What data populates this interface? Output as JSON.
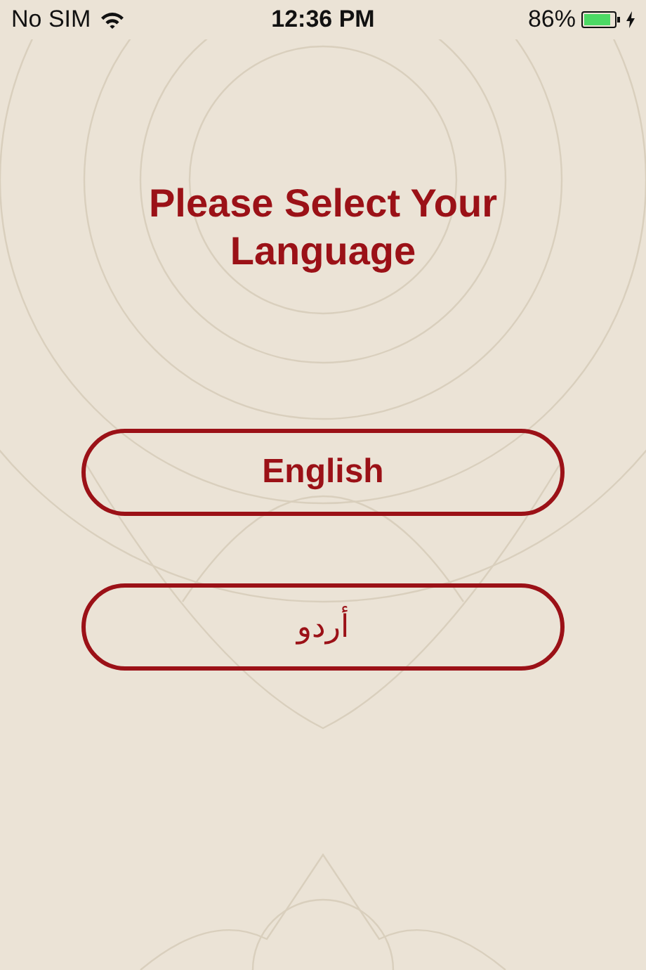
{
  "status_bar": {
    "carrier": "No SIM",
    "time": "12:36 PM",
    "battery": "86%"
  },
  "title": "Please Select Your Language",
  "languages": [
    {
      "label": "English",
      "kind": "latin"
    },
    {
      "label": "أردو",
      "kind": "arabic"
    }
  ]
}
